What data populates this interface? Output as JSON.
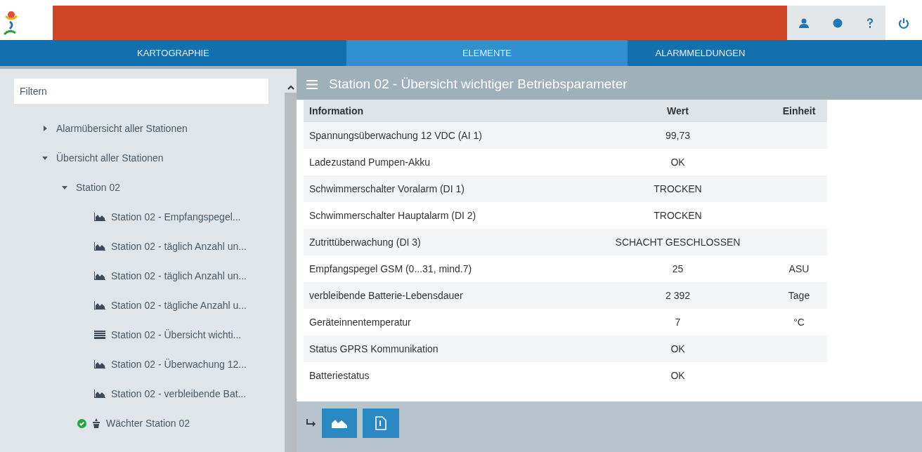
{
  "nav": {
    "tabs": [
      {
        "label": "KARTOGRAPHIE",
        "selected": false
      },
      {
        "label": "ELEMENTE",
        "selected": true
      },
      {
        "label": "ALARMMELDUNGEN",
        "selected": false
      }
    ]
  },
  "sidebar": {
    "filter": {
      "placeholder": "Filtern"
    },
    "tree": [
      {
        "label": "Alarmübersicht aller Stationen",
        "expanded": false
      },
      {
        "label": "Übersicht aller Stationen",
        "expanded": true,
        "children": [
          {
            "label": "Station 02",
            "expanded": true,
            "children": [
              {
                "label": "Station 02 - Empfangspegel...",
                "kind": "chart"
              },
              {
                "label": "Station 02 - täglich Anzahl un...",
                "kind": "chart"
              },
              {
                "label": "Station 02 - täglich Anzahl un...",
                "kind": "chart"
              },
              {
                "label": "Station 02 - tägliche Anzahl u...",
                "kind": "chart"
              },
              {
                "label": "Station 02 - Übersicht wichti...",
                "kind": "table"
              },
              {
                "label": "Station 02 - Überwachung 12...",
                "kind": "chart"
              },
              {
                "label": "Station 02 - verbleibende Bat...",
                "kind": "chart"
              }
            ]
          },
          {
            "label": "Wächter Station 02",
            "kind": "device",
            "ok": true
          }
        ]
      }
    ]
  },
  "panel": {
    "title": "Station 02 - Übersicht wichtiger Betriebsparameter",
    "table": {
      "columns": [
        "Information",
        "Wert",
        "Einheit"
      ],
      "rows": [
        [
          "Spannungsüberwachung 12 VDC (AI 1)",
          "99,73",
          ""
        ],
        [
          "Ladezustand Pumpen-Akku",
          "OK",
          ""
        ],
        [
          "Schwimmerschalter Voralarm (DI 1)",
          "TROCKEN",
          ""
        ],
        [
          "Schwimmerschalter Hauptalarm (DI 2)",
          "TROCKEN",
          ""
        ],
        [
          "Zutrittüberwachung (DI 3)",
          "SCHACHT GESCHLOSSEN",
          ""
        ],
        [
          "Empfangspegel GSM (0...31, mind.7)",
          "25",
          "ASU"
        ],
        [
          "verbleibende Batterie-Lebensdauer",
          "2 392",
          "Tage"
        ],
        [
          "Geräteinnentemperatur",
          "7",
          "°C"
        ],
        [
          "Status GPRS Kommunikation",
          "OK",
          ""
        ],
        [
          "Batteriestatus",
          "OK",
          ""
        ]
      ]
    }
  }
}
